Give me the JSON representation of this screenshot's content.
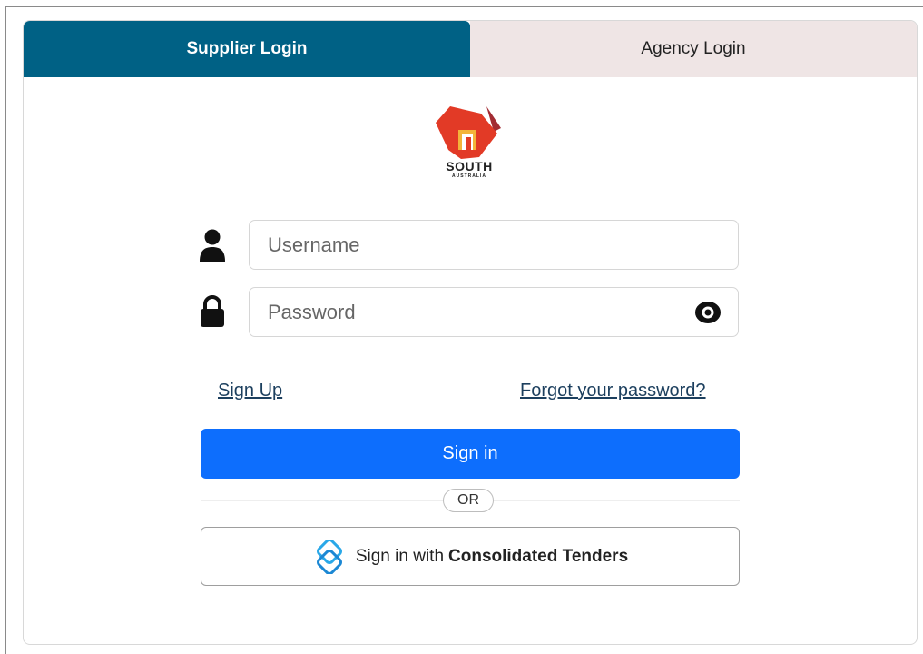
{
  "tabs": {
    "supplier": "Supplier Login",
    "agency": "Agency Login"
  },
  "logo": {
    "name": "south-australia-logo",
    "text_main": "SOUTH",
    "text_sub": "AUSTRALIA"
  },
  "form": {
    "username_placeholder": "Username",
    "password_placeholder": "Password",
    "sign_up": "Sign Up",
    "forgot_password": "Forgot your password?",
    "sign_in": "Sign in",
    "or": "OR",
    "sso_prefix": "Sign in with",
    "sso_name": "Consolidated Tenders"
  },
  "icons": {
    "username": "user-icon",
    "password": "lock-icon",
    "show_password": "eye-icon",
    "sso": "consolidated-tenders-icon"
  },
  "colors": {
    "active_tab": "#006185",
    "inactive_tab": "#efe5e5",
    "primary_button": "#0d6efd",
    "link": "#1c3f5e",
    "logo_red": "#e23a26",
    "logo_dark_red": "#a22c33"
  }
}
